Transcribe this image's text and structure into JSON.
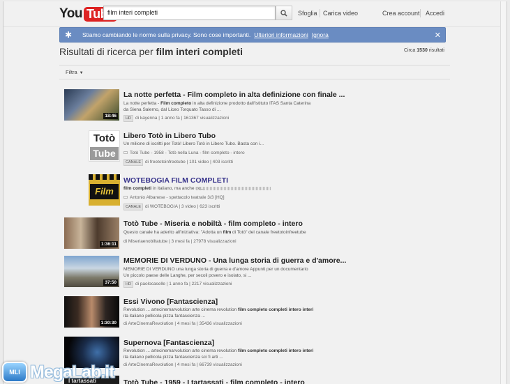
{
  "header": {
    "logo_you": "You",
    "logo_tube": "Tube",
    "search_value": "film interi completi",
    "nav": {
      "browse": "Sfoglia",
      "upload": "Carica video",
      "create_account": "Crea account",
      "sign_in": "Accedi"
    }
  },
  "privacy_bar": {
    "message": "Stiamo cambiando le norme sulla privacy. Sono cose importanti.",
    "more_info": "Ulteriori informazioni",
    "dismiss": "Ignora"
  },
  "search": {
    "title_prefix": "Risultati di ricerca per",
    "query": "film interi completi",
    "count_prefix": "Circa",
    "count": "1530",
    "count_suffix": "risultati",
    "filter_label": "Filtra"
  },
  "results": [
    {
      "title": "La notte perfetta - Film completo in alta definizione con finale ...",
      "desc_html": "La notte perfetta - <b>Film completo</b> in alta definizione prodotto dall'Istituto ITAS Santa Caterina da Siena Salerno, dal Liceo Torquato Tasso di ...",
      "duration": "18:46",
      "badge": "HD",
      "meta": "di kayenna | 1 anno fa | 161367 visualizzazioni"
    },
    {
      "title": "Libero Totò in Libero Tubo",
      "desc_html": "Un milione di iscritti per Totò! Libero Totò in Libero Tubo. Basta con i...",
      "thumb_top": "Totò",
      "thumb_bottom": "Tube",
      "sub": "Totò Tube - 1958 - Totò nella Luna - film completo - intero",
      "badge": "CANALE",
      "meta": "di freetotoinfreetube | 101 video | 403 iscritti"
    },
    {
      "title": "WOTEBOGIA FILM COMPLETI",
      "desc_html": "<b>film completi</b> in italiano, ma anche no...",
      "thumb_text": "Film",
      "sub": "Antonio Albanese - spettacolo teatrale 3/3 [HQ]",
      "badge": "CANALE",
      "meta": "di WOTEBOGIA | 3 video | 623 iscritti"
    },
    {
      "title": "Totò Tube - Miseria e nobiltà - film completo - intero",
      "desc_html": "Questo canale ha aderito all'iniziativa: \"Adotta un <b>film</b> di Totò\" del canale freetotoinfreetube",
      "duration": "1:36:11",
      "meta": "di Miseriaenobiltatube | 3 mesi fa | 27978 visualizzazioni"
    },
    {
      "title": "MEMORIE DI VERDUNO - Una lunga storia di guerra e d'amore...",
      "desc_html": "MEMORIE DI VERDUNO una lunga storia di guerra e d'amore Appunti per un documentario Un piccolo paese delle Langhe, per secoli povero e isolato, si ...",
      "duration": "37:50",
      "badge": "HD",
      "meta": "di paolocaselle | 1 anno fa | 2217 visualizzazioni"
    },
    {
      "title": "Essi Vivono [Fantascienza]",
      "desc_html": "Revolution ... artecinemarvolution arte cinema revolution <b>film completo completi intero interi</b> ita italiano pellicola pizza fantascienza ...",
      "duration": "1:30:30",
      "meta": "di ArteCinemaRevolution | 4 mesi fa | 35436 visualizzazioni"
    },
    {
      "title": "Supernova [Fantascienza]",
      "desc_html": "Revolution ... artecinemarvolution arte cinema revolution <b>film completo completi intero interi</b> ita italiano pellicola pizza fantascienza sci fi arti ...",
      "duration": "",
      "meta": "di ArteCinemaRevolution | 4 mesi fa | 66739 visualizzazioni"
    },
    {
      "title": "Totò Tube - 1959 - I tartassati - film completo - intero",
      "thumb_text": "I tartassati"
    }
  ],
  "watermark": {
    "badge": "MLI",
    "text": "MegaLab.it"
  },
  "colors": {
    "privacy_bar": "#6a8cc2",
    "logo_red": "#dd2222",
    "playlist_title": "#37338b"
  }
}
